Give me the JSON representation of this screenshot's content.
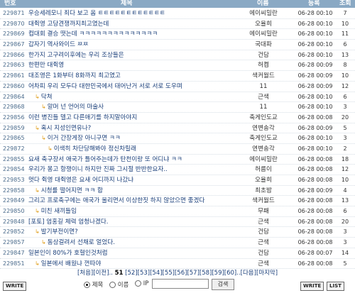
{
  "header": {
    "num": "번호",
    "title": "제목",
    "name": "이름",
    "date": "등록",
    "views": "조회"
  },
  "posts": [
    {
      "num": "229871",
      "title": "우승세레모니 죄다 보고 옴 ㅌㅌㅌㅌㅌㅌㅌㅌㅌㅌㅌㅌ",
      "reply": false,
      "depth": 0,
      "name": "에이씨밀란",
      "date": "06-28 00:10",
      "views": "7"
    },
    {
      "num": "229870",
      "title": "대쥑영 고당견쟁까지최고였는데",
      "reply": false,
      "depth": 0,
      "name": "오율희",
      "date": "06-28 00:10",
      "views": "10"
    },
    {
      "num": "229869",
      "title": "컵대회 결승 떳는데 ㅋㅋㅋㅋㅋㅋㅋㅋㅋㅋㅋㅋㅋㅋ",
      "reply": false,
      "depth": 0,
      "name": "에이씨밀란",
      "date": "06-28 00:10",
      "views": "11"
    },
    {
      "num": "229867",
      "title": "갑자기 역사와이드 ㅉㅉ",
      "reply": false,
      "depth": 0,
      "name": "국대파",
      "date": "06-28 00:10",
      "views": "6"
    },
    {
      "num": "229866",
      "title": "한가지 고구려이후에는 우리 조상들은",
      "reply": false,
      "depth": 0,
      "name": "건담",
      "date": "06-28 00:10",
      "views": "13"
    },
    {
      "num": "229863",
      "title": "한편만 대쥑영",
      "reply": false,
      "depth": 0,
      "name": "허켬",
      "date": "06-28 00:09",
      "views": "8"
    },
    {
      "num": "229861",
      "title": "대조영은 1화부터 8화까지 최고였고",
      "reply": false,
      "depth": 0,
      "name": "색커월드",
      "date": "06-28 00:09",
      "views": "10"
    },
    {
      "num": "229860",
      "title": "어차피 우리 모두다 대한민국에서 태어난거 서로 서로 도우며",
      "reply": false,
      "depth": 0,
      "name": "11",
      "date": "06-28 00:09",
      "views": "12"
    },
    {
      "num": "229864",
      "title": "닥쳐",
      "reply": true,
      "depth": 1,
      "name": "근색",
      "date": "06-28 00:10",
      "views": "6"
    },
    {
      "num": "229868",
      "title": "알머 넌 언어의 마술사",
      "reply": true,
      "depth": 2,
      "name": "11",
      "date": "06-28 00:10",
      "views": "3"
    },
    {
      "num": "229856",
      "title": "이런 병진들 델고 다른애기를 하지말아야지",
      "reply": false,
      "depth": 0,
      "name": "축게인도교",
      "date": "06-28 00:08",
      "views": "20"
    },
    {
      "num": "229859",
      "title": "혹시 지성인면유나?",
      "reply": true,
      "depth": 1,
      "name": "연변송각",
      "date": "06-28 00:09",
      "views": "5"
    },
    {
      "num": "229865",
      "title": "이거 간장게장 아니구면 ㅋㅋ",
      "reply": true,
      "depth": 2,
      "name": "축게인도교",
      "date": "06-28 00:10",
      "views": "3"
    },
    {
      "num": "229872",
      "title": "이색히 차단당해봐야 정신차릴래",
      "reply": true,
      "depth": 3,
      "name": "연변송각",
      "date": "06-28 00:10",
      "views": "2"
    },
    {
      "num": "229855",
      "title": "요새 축구장서 애국가 틀어주는데가 탄천이랑 또 어디냐 ㅋㅋ",
      "reply": false,
      "depth": 0,
      "name": "에이씨밀란",
      "date": "06-28 00:08",
      "views": "18"
    },
    {
      "num": "229854",
      "title": "우리가 몽고 항쟁이니 하지만 진짜 그시절 반반한요자..",
      "reply": false,
      "depth": 0,
      "name": "허름이",
      "date": "06-28 00:08",
      "views": "12"
    },
    {
      "num": "229853",
      "title": "멋다 쥑영 대쥑영은 요새 어디까지 나갔냐",
      "reply": false,
      "depth": 0,
      "name": "오율희",
      "date": "06-28 00:08",
      "views": "10"
    },
    {
      "num": "229858",
      "title": "시청률 떨어지면 ㅋㅋ 합",
      "reply": true,
      "depth": 1,
      "name": "최초밤",
      "date": "06-28 00:09",
      "views": "4"
    },
    {
      "num": "229849",
      "title": "그리고 프로축구에는 애국가 울리면서 이상한짓 하지 않았으면 좋겠다",
      "reply": false,
      "depth": 0,
      "name": "색커월드",
      "date": "06-28 00:08",
      "views": "13"
    },
    {
      "num": "229850",
      "title": "미친 새끼들임",
      "reply": true,
      "depth": 1,
      "name": "무패",
      "date": "06-28 00:08",
      "views": "6"
    },
    {
      "num": "229848",
      "title": "[포토] 엄홍길 체력 엄청나겠다.",
      "reply": false,
      "depth": 0,
      "name": "근색",
      "date": "06-28 00:08",
      "views": "20"
    },
    {
      "num": "229852",
      "title": "발기부전이면?",
      "reply": true,
      "depth": 1,
      "name": "건담",
      "date": "06-28 00:08",
      "views": "3"
    },
    {
      "num": "229857",
      "title": "동상걸려서 선채로 얼었다.",
      "reply": true,
      "depth": 2,
      "name": "근색",
      "date": "06-28 00:08",
      "views": "3"
    },
    {
      "num": "229847",
      "title": "일본인이 80%가 호혈인것처럼",
      "reply": false,
      "depth": 0,
      "name": "건담",
      "date": "06-28 00:07",
      "views": "14"
    },
    {
      "num": "229851",
      "title": "일본에서 배웠냐 껀따야",
      "reply": true,
      "depth": 1,
      "name": "근색",
      "date": "06-28 00:08",
      "views": "5"
    }
  ],
  "pagination": {
    "first": "[처음]",
    "prev": "[이전]..",
    "current": "51",
    "pages": [
      "[52]",
      "[53]",
      "[54]",
      "[55]",
      "[56]",
      "[57]",
      "[58]",
      "[59]",
      "[60]"
    ],
    "next": "..[다음]",
    "last": "[마지막]"
  },
  "buttons": {
    "write": "WRITE",
    "list": "LIST"
  },
  "search": {
    "options": [
      "제목",
      "이름",
      "IP"
    ],
    "selected": "제목",
    "input_value": "",
    "submit": "검색"
  }
}
